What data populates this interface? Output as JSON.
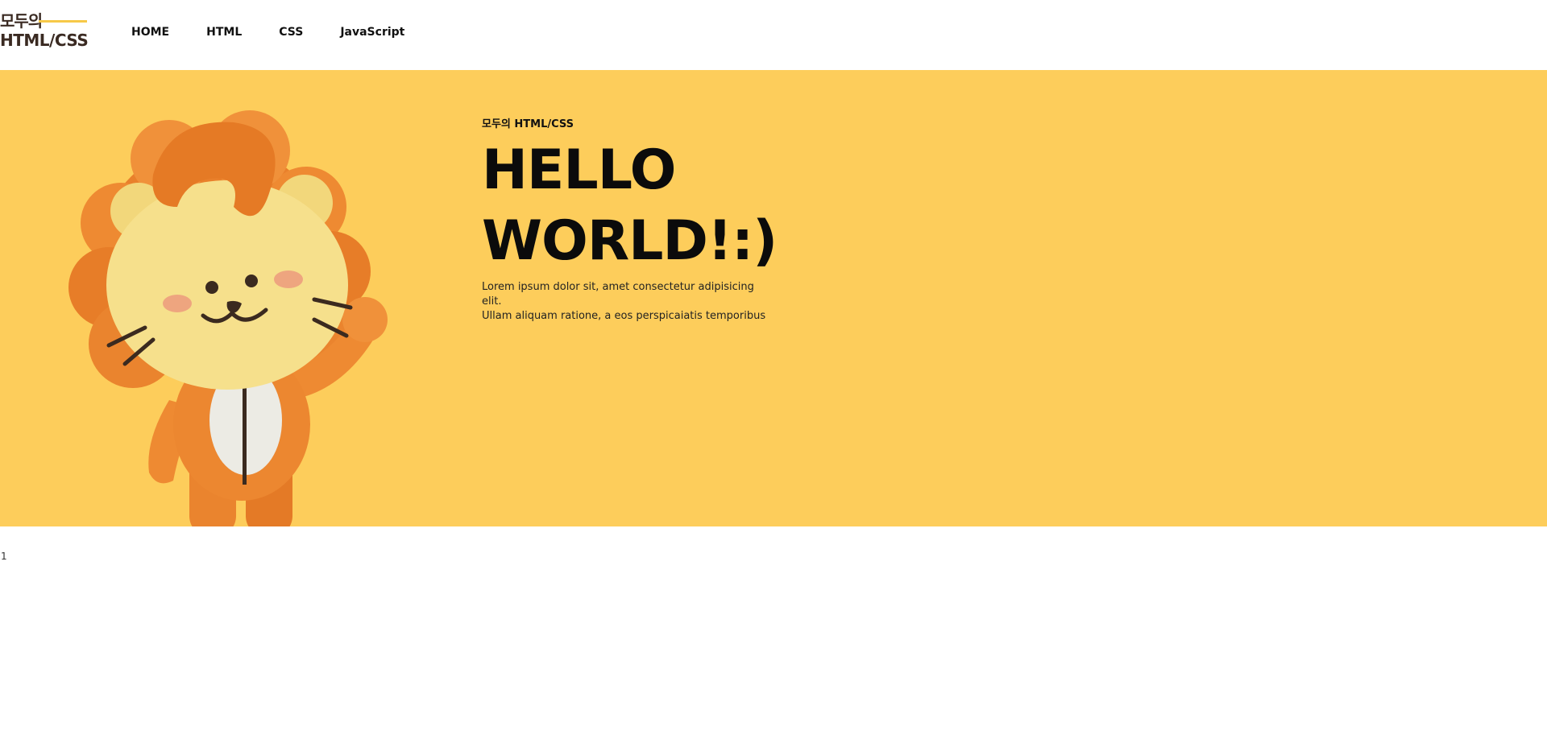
{
  "logo": {
    "line1": "모두의",
    "line2": "HTML/CSS"
  },
  "nav": {
    "items": [
      {
        "label": "HOME"
      },
      {
        "label": "HTML"
      },
      {
        "label": "CSS"
      },
      {
        "label": "JavaScript"
      }
    ]
  },
  "hero": {
    "subtitle": "모두의 HTML/CSS",
    "title_line1": "HELLO",
    "title_line2": "WORLD!:)",
    "desc_line1": "Lorem ipsum dolor sit, amet consectetur adipisicing elit.",
    "desc_line2": "Ullam aliquam ratione, a eos perspicaiatis temporibus",
    "background_color": "#fdcd5b",
    "image": "lion-mascot"
  },
  "footer": {
    "page_number": "1"
  }
}
